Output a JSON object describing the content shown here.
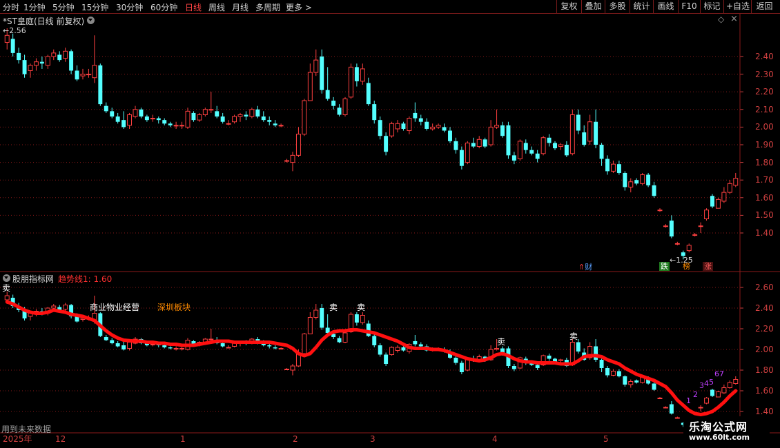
{
  "toolbar": {
    "periods": [
      "分时",
      "1分钟",
      "5分钟",
      "15分钟",
      "30分钟",
      "60分钟",
      "日线",
      "周线",
      "月线",
      "多周期",
      "更多 >"
    ],
    "active_period": "日线",
    "buttons": [
      "复权",
      "叠加",
      "多股",
      "统计",
      "画线",
      "F10",
      "标记",
      "+自选",
      "返回"
    ]
  },
  "main_pane": {
    "title": "*ST皇庭(日线 前复权)",
    "high_marker": "2.56",
    "low_marker": "1.25",
    "y_ticks": [
      "2.40",
      "2.30",
      "2.20",
      "2.10",
      "2.00",
      "1.90",
      "1.80",
      "1.70",
      "1.60",
      "1.50",
      "1.40"
    ],
    "tags": {
      "cai": "财",
      "die": "跌",
      "bang": "榜",
      "zhang": "涨"
    }
  },
  "indicator_pane": {
    "source": "股朋指标网",
    "line_label": "趋势线1: 1.60",
    "sector_1": "商业物业经营",
    "sector_2": "深圳板块",
    "sell_label": "卖",
    "count_labels": [
      "1",
      "2",
      "3",
      "4",
      "5",
      "6",
      "7"
    ],
    "y_ticks": [
      "2.60",
      "2.40",
      "2.20",
      "2.00",
      "1.80",
      "1.60",
      "1.40"
    ],
    "footer_note": "用到未来数据"
  },
  "date_axis": {
    "labels": [
      "2025年",
      "12",
      "1",
      "2",
      "3",
      "4",
      "5"
    ]
  },
  "watermark": {
    "title": "乐淘公式网",
    "url": "www.60lt.com"
  },
  "colors": {
    "up": "#ff4040",
    "down": "#54ffff",
    "trend": "#ff1010",
    "axis": "#d04040",
    "grid": "#8b1a1a"
  },
  "chart_data": {
    "type": "candlestick",
    "y_range": [
      1.22,
      2.58
    ],
    "candles": [
      {
        "o": 2.48,
        "h": 2.56,
        "l": 2.44,
        "c": 2.52
      },
      {
        "o": 2.5,
        "h": 2.53,
        "l": 2.4,
        "c": 2.42
      },
      {
        "o": 2.42,
        "h": 2.45,
        "l": 2.36,
        "c": 2.38
      },
      {
        "o": 2.38,
        "h": 2.41,
        "l": 2.28,
        "c": 2.3
      },
      {
        "o": 2.32,
        "h": 2.36,
        "l": 2.28,
        "c": 2.35
      },
      {
        "o": 2.35,
        "h": 2.39,
        "l": 2.32,
        "c": 2.37
      },
      {
        "o": 2.37,
        "h": 2.4,
        "l": 2.33,
        "c": 2.36
      },
      {
        "o": 2.35,
        "h": 2.41,
        "l": 2.33,
        "c": 2.4
      },
      {
        "o": 2.4,
        "h": 2.44,
        "l": 2.38,
        "c": 2.42
      },
      {
        "o": 2.41,
        "h": 2.43,
        "l": 2.37,
        "c": 2.38
      },
      {
        "o": 2.39,
        "h": 2.45,
        "l": 2.37,
        "c": 2.43
      },
      {
        "o": 2.43,
        "h": 2.44,
        "l": 2.3,
        "c": 2.32
      },
      {
        "o": 2.32,
        "h": 2.35,
        "l": 2.26,
        "c": 2.27
      },
      {
        "o": 2.29,
        "h": 2.33,
        "l": 2.27,
        "c": 2.3
      },
      {
        "o": 2.3,
        "h": 2.33,
        "l": 2.28,
        "c": 2.3
      },
      {
        "o": 2.28,
        "h": 2.52,
        "l": 2.25,
        "c": 2.35
      },
      {
        "o": 2.35,
        "h": 2.36,
        "l": 2.12,
        "c": 2.13
      },
      {
        "o": 2.12,
        "h": 2.14,
        "l": 2.08,
        "c": 2.09
      },
      {
        "o": 2.09,
        "h": 2.11,
        "l": 2.05,
        "c": 2.06
      },
      {
        "o": 2.06,
        "h": 2.08,
        "l": 2.02,
        "c": 2.03
      },
      {
        "o": 2.04,
        "h": 2.09,
        "l": 1.99,
        "c": 2.0
      },
      {
        "o": 2.01,
        "h": 2.08,
        "l": 1.99,
        "c": 2.07
      },
      {
        "o": 2.06,
        "h": 2.12,
        "l": 2.05,
        "c": 2.1
      },
      {
        "o": 2.1,
        "h": 2.11,
        "l": 2.05,
        "c": 2.06
      },
      {
        "o": 2.06,
        "h": 2.07,
        "l": 2.03,
        "c": 2.04
      },
      {
        "o": 2.05,
        "h": 2.07,
        "l": 2.03,
        "c": 2.05
      },
      {
        "o": 2.05,
        "h": 2.06,
        "l": 2.02,
        "c": 2.04
      },
      {
        "o": 2.04,
        "h": 2.05,
        "l": 2.01,
        "c": 2.02
      },
      {
        "o": 2.02,
        "h": 2.03,
        "l": 2.0,
        "c": 2.01
      },
      {
        "o": 2.01,
        "h": 2.03,
        "l": 1.99,
        "c": 2.01
      },
      {
        "o": 2.01,
        "h": 2.03,
        "l": 1.99,
        "c": 2.01
      },
      {
        "o": 2.0,
        "h": 2.11,
        "l": 1.99,
        "c": 2.09
      },
      {
        "o": 2.08,
        "h": 2.09,
        "l": 2.03,
        "c": 2.04
      },
      {
        "o": 2.04,
        "h": 2.08,
        "l": 2.03,
        "c": 2.07
      },
      {
        "o": 2.07,
        "h": 2.11,
        "l": 2.06,
        "c": 2.1
      },
      {
        "o": 2.1,
        "h": 2.2,
        "l": 2.08,
        "c": 2.1
      },
      {
        "o": 2.09,
        "h": 2.12,
        "l": 2.05,
        "c": 2.06
      },
      {
        "o": 2.06,
        "h": 2.08,
        "l": 2.02,
        "c": 2.03
      },
      {
        "o": 2.02,
        "h": 2.04,
        "l": 2.01,
        "c": 2.02
      },
      {
        "o": 2.03,
        "h": 2.07,
        "l": 2.02,
        "c": 2.06
      },
      {
        "o": 2.06,
        "h": 2.08,
        "l": 2.03,
        "c": 2.07
      },
      {
        "o": 2.07,
        "h": 2.09,
        "l": 2.04,
        "c": 2.06
      },
      {
        "o": 2.06,
        "h": 2.11,
        "l": 2.05,
        "c": 2.1
      },
      {
        "o": 2.1,
        "h": 2.12,
        "l": 2.05,
        "c": 2.06
      },
      {
        "o": 2.06,
        "h": 2.09,
        "l": 2.03,
        "c": 2.04
      },
      {
        "o": 2.04,
        "h": 2.06,
        "l": 2.01,
        "c": 2.03
      },
      {
        "o": 2.02,
        "h": 2.04,
        "l": 2.0,
        "c": 2.01
      },
      {
        "o": 2.01,
        "h": 2.02,
        "l": 2.0,
        "c": 2.01
      },
      {
        "o": 1.81,
        "h": 1.82,
        "l": 1.8,
        "c": 1.81
      },
      {
        "o": 1.8,
        "h": 1.86,
        "l": 1.75,
        "c": 1.84
      },
      {
        "o": 1.84,
        "h": 2.0,
        "l": 1.83,
        "c": 1.96
      },
      {
        "o": 1.96,
        "h": 2.16,
        "l": 1.95,
        "c": 2.15
      },
      {
        "o": 2.15,
        "h": 2.36,
        "l": 2.15,
        "c": 2.31
      },
      {
        "o": 2.31,
        "h": 2.44,
        "l": 2.29,
        "c": 2.38
      },
      {
        "o": 2.4,
        "h": 2.44,
        "l": 2.19,
        "c": 2.21
      },
      {
        "o": 2.21,
        "h": 2.34,
        "l": 2.15,
        "c": 2.16
      },
      {
        "o": 2.15,
        "h": 2.17,
        "l": 2.1,
        "c": 2.12
      },
      {
        "o": 2.11,
        "h": 2.13,
        "l": 2.06,
        "c": 2.07
      },
      {
        "o": 2.07,
        "h": 2.17,
        "l": 2.06,
        "c": 2.16
      },
      {
        "o": 2.17,
        "h": 2.36,
        "l": 2.16,
        "c": 2.34
      },
      {
        "o": 2.34,
        "h": 2.36,
        "l": 2.23,
        "c": 2.26
      },
      {
        "o": 2.26,
        "h": 2.36,
        "l": 2.24,
        "c": 2.33
      },
      {
        "o": 2.25,
        "h": 2.28,
        "l": 2.12,
        "c": 2.13
      },
      {
        "o": 2.13,
        "h": 2.15,
        "l": 2.02,
        "c": 2.04
      },
      {
        "o": 2.04,
        "h": 2.06,
        "l": 1.93,
        "c": 1.95
      },
      {
        "o": 1.95,
        "h": 1.97,
        "l": 1.84,
        "c": 1.86
      },
      {
        "o": 1.95,
        "h": 2.03,
        "l": 1.94,
        "c": 2.02
      },
      {
        "o": 1.99,
        "h": 2.04,
        "l": 1.97,
        "c": 2.02
      },
      {
        "o": 2.02,
        "h": 2.03,
        "l": 1.98,
        "c": 1.99
      },
      {
        "o": 1.98,
        "h": 2.06,
        "l": 1.96,
        "c": 2.05
      },
      {
        "o": 2.08,
        "h": 2.14,
        "l": 2.03,
        "c": 2.05
      },
      {
        "o": 2.05,
        "h": 2.07,
        "l": 2.01,
        "c": 2.03
      },
      {
        "o": 2.03,
        "h": 2.05,
        "l": 1.98,
        "c": 1.99
      },
      {
        "o": 1.99,
        "h": 2.02,
        "l": 1.98,
        "c": 2.0
      },
      {
        "o": 2.0,
        "h": 2.02,
        "l": 1.99,
        "c": 2.01
      },
      {
        "o": 2.0,
        "h": 2.02,
        "l": 1.97,
        "c": 1.98
      },
      {
        "o": 1.98,
        "h": 2.0,
        "l": 1.91,
        "c": 1.92
      },
      {
        "o": 1.92,
        "h": 1.94,
        "l": 1.85,
        "c": 1.87
      },
      {
        "o": 1.87,
        "h": 1.89,
        "l": 1.76,
        "c": 1.78
      },
      {
        "o": 1.8,
        "h": 1.92,
        "l": 1.79,
        "c": 1.91
      },
      {
        "o": 1.91,
        "h": 1.94,
        "l": 1.88,
        "c": 1.89
      },
      {
        "o": 1.89,
        "h": 1.95,
        "l": 1.88,
        "c": 1.93
      },
      {
        "o": 1.93,
        "h": 1.94,
        "l": 1.88,
        "c": 1.89
      },
      {
        "o": 1.9,
        "h": 2.04,
        "l": 1.89,
        "c": 2.0
      },
      {
        "o": 2.0,
        "h": 2.1,
        "l": 1.99,
        "c": 2.01
      },
      {
        "o": 2.01,
        "h": 2.03,
        "l": 1.94,
        "c": 1.95
      },
      {
        "o": 2.01,
        "h": 2.03,
        "l": 1.82,
        "c": 1.84
      },
      {
        "o": 1.84,
        "h": 1.86,
        "l": 1.79,
        "c": 1.81
      },
      {
        "o": 1.82,
        "h": 1.93,
        "l": 1.81,
        "c": 1.92
      },
      {
        "o": 1.91,
        "h": 1.93,
        "l": 1.85,
        "c": 1.87
      },
      {
        "o": 1.87,
        "h": 1.89,
        "l": 1.84,
        "c": 1.85
      },
      {
        "o": 1.85,
        "h": 1.87,
        "l": 1.8,
        "c": 1.82
      },
      {
        "o": 1.85,
        "h": 1.95,
        "l": 1.84,
        "c": 1.94
      },
      {
        "o": 1.94,
        "h": 1.96,
        "l": 1.89,
        "c": 1.91
      },
      {
        "o": 1.91,
        "h": 1.92,
        "l": 1.87,
        "c": 1.88
      },
      {
        "o": 1.89,
        "h": 1.91,
        "l": 1.87,
        "c": 1.9
      },
      {
        "o": 1.9,
        "h": 1.92,
        "l": 1.83,
        "c": 1.84
      },
      {
        "o": 1.85,
        "h": 2.1,
        "l": 1.84,
        "c": 2.07
      },
      {
        "o": 2.07,
        "h": 2.1,
        "l": 1.96,
        "c": 1.98
      },
      {
        "o": 1.97,
        "h": 2.01,
        "l": 1.89,
        "c": 1.9
      },
      {
        "o": 1.92,
        "h": 2.07,
        "l": 1.9,
        "c": 2.03
      },
      {
        "o": 2.03,
        "h": 2.1,
        "l": 1.88,
        "c": 1.9
      },
      {
        "o": 1.9,
        "h": 1.91,
        "l": 1.78,
        "c": 1.82
      },
      {
        "o": 1.82,
        "h": 1.84,
        "l": 1.73,
        "c": 1.75
      },
      {
        "o": 1.75,
        "h": 1.81,
        "l": 1.74,
        "c": 1.79
      },
      {
        "o": 1.79,
        "h": 1.81,
        "l": 1.73,
        "c": 1.74
      },
      {
        "o": 1.74,
        "h": 1.75,
        "l": 1.64,
        "c": 1.66
      },
      {
        "o": 1.66,
        "h": 1.71,
        "l": 1.63,
        "c": 1.69
      },
      {
        "o": 1.7,
        "h": 1.71,
        "l": 1.67,
        "c": 1.68
      },
      {
        "o": 1.68,
        "h": 1.74,
        "l": 1.67,
        "c": 1.73
      },
      {
        "o": 1.73,
        "h": 1.74,
        "l": 1.66,
        "c": 1.67
      },
      {
        "o": 1.67,
        "h": 1.69,
        "l": 1.6,
        "c": 1.61
      },
      {
        "o": 1.53,
        "h": 1.54,
        "l": 1.52,
        "c": 1.53
      },
      {
        "o": 1.44,
        "h": 1.45,
        "l": 1.43,
        "c": 1.44
      },
      {
        "o": 1.47,
        "h": 1.5,
        "l": 1.37,
        "c": 1.38
      },
      {
        "o": 1.34,
        "h": 1.35,
        "l": 1.33,
        "c": 1.34
      },
      {
        "o": 1.29,
        "h": 1.3,
        "l": 1.25,
        "c": 1.27
      },
      {
        "o": 1.3,
        "h": 1.34,
        "l": 1.29,
        "c": 1.33
      },
      {
        "o": 1.39,
        "h": 1.4,
        "l": 1.38,
        "c": 1.39
      },
      {
        "o": 1.44,
        "h": 1.46,
        "l": 1.4,
        "c": 1.44
      },
      {
        "o": 1.48,
        "h": 1.54,
        "l": 1.47,
        "c": 1.53
      },
      {
        "o": 1.61,
        "h": 1.62,
        "l": 1.54,
        "c": 1.55
      },
      {
        "o": 1.54,
        "h": 1.6,
        "l": 1.54,
        "c": 1.59
      },
      {
        "o": 1.58,
        "h": 1.66,
        "l": 1.57,
        "c": 1.63
      },
      {
        "o": 1.63,
        "h": 1.7,
        "l": 1.62,
        "c": 1.68
      },
      {
        "o": 1.67,
        "h": 1.74,
        "l": 1.66,
        "c": 1.71
      }
    ],
    "trend_line": [
      2.46,
      2.44,
      2.41,
      2.38,
      2.36,
      2.35,
      2.35,
      2.36,
      2.38,
      2.37,
      2.36,
      2.34,
      2.33,
      2.32,
      2.3,
      2.28,
      2.23,
      2.18,
      2.14,
      2.11,
      2.09,
      2.08,
      2.08,
      2.07,
      2.07,
      2.06,
      2.06,
      2.05,
      2.05,
      2.04,
      2.04,
      2.04,
      2.05,
      2.06,
      2.07,
      2.08,
      2.08,
      2.08,
      2.07,
      2.07,
      2.07,
      2.07,
      2.07,
      2.07,
      2.07,
      2.06,
      2.05,
      2.04,
      2.01,
      1.96,
      1.94,
      1.96,
      2.02,
      2.09,
      2.14,
      2.17,
      2.18,
      2.18,
      2.19,
      2.19,
      2.18,
      2.16,
      2.14,
      2.12,
      2.1,
      2.08,
      2.05,
      2.02,
      2.01,
      2.01,
      2.01,
      2.0,
      2.0,
      1.99,
      1.97,
      1.95,
      1.93,
      1.91,
      1.9,
      1.89,
      1.9,
      1.92,
      1.95,
      1.96,
      1.94,
      1.91,
      1.89,
      1.88,
      1.88,
      1.87,
      1.87,
      1.87,
      1.87,
      1.86,
      1.86,
      1.86,
      1.89,
      1.93,
      1.94,
      1.94,
      1.93,
      1.9,
      1.86,
      1.82,
      1.79,
      1.76,
      1.74,
      1.72,
      1.7,
      1.67,
      1.64,
      1.58,
      1.51,
      1.46,
      1.41,
      1.38,
      1.37,
      1.38,
      1.4,
      1.44,
      1.49,
      1.55,
      1.6
    ]
  }
}
